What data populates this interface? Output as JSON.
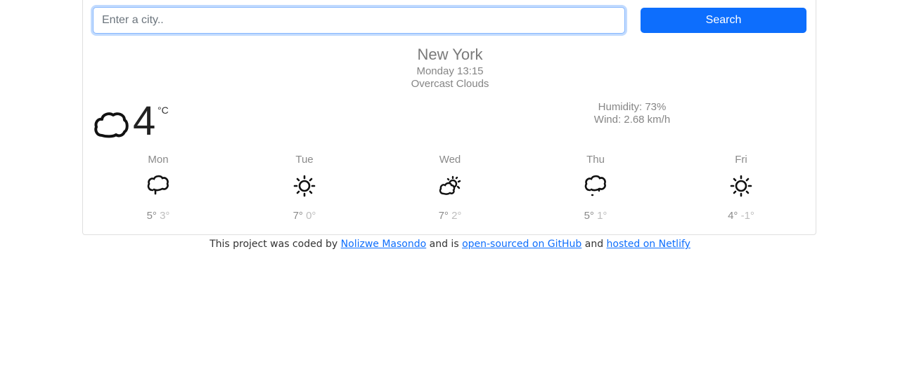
{
  "search": {
    "placeholder": "Enter a city..",
    "value": "",
    "button_label": "Search"
  },
  "current": {
    "city": "New York",
    "datetime": "Monday 13:15",
    "description": "Overcast Clouds",
    "icon": "cloud-icon",
    "temperature": "4",
    "unit": "°C",
    "humidity": "Humidity: 73%",
    "wind": "Wind: 2.68 km/h"
  },
  "forecast": [
    {
      "day": "Mon",
      "icon": "cloud-drizzle-icon",
      "max": "5°",
      "min": "3°"
    },
    {
      "day": "Tue",
      "icon": "sun-icon",
      "max": "7°",
      "min": "0°"
    },
    {
      "day": "Wed",
      "icon": "partly-cloudy-icon",
      "max": "7°",
      "min": "2°"
    },
    {
      "day": "Thu",
      "icon": "cloud-drizzle-icon",
      "max": "5°",
      "min": "1°"
    },
    {
      "day": "Fri",
      "icon": "sun-icon",
      "max": "4°",
      "min": "-1°"
    }
  ],
  "footer": {
    "prefix": "This project was coded by ",
    "author_link": "Nolizwe Masondo",
    "middle1": " and is ",
    "github_link": "open-sourced on GitHub",
    "middle2": " and ",
    "netlify_link": "hosted on Netlify"
  }
}
